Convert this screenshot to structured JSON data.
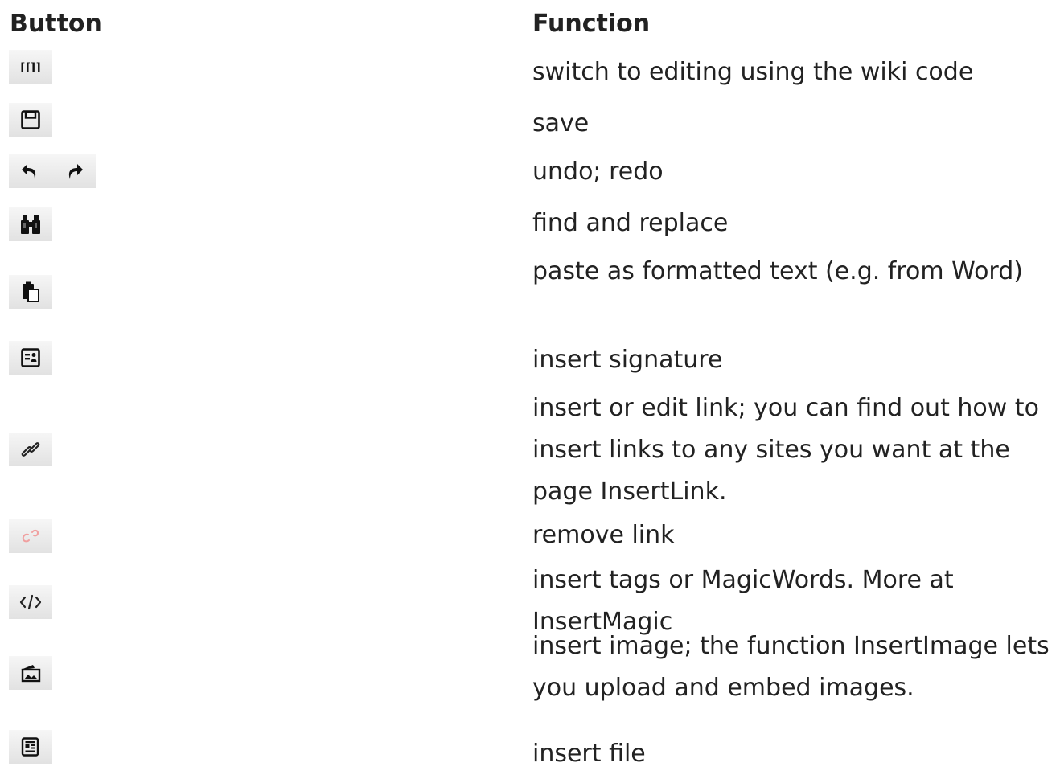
{
  "header": {
    "button": "Button",
    "function": "Function"
  },
  "rows": [
    {
      "icons": [
        "wiki-code-icon"
      ],
      "function": "switch to editing using the wiki code"
    },
    {
      "icons": [
        "floppy-disk-icon"
      ],
      "function": "save"
    },
    {
      "icons": [
        "undo-icon",
        "redo-icon"
      ],
      "function": "undo; redo"
    },
    {
      "icons": [
        "binoculars-icon"
      ],
      "function": "find and replace"
    },
    {
      "icons": [
        "paste-formatted-icon"
      ],
      "function": "paste as formatted text (e.g. from Word)"
    },
    {
      "icons": [
        "signature-icon"
      ],
      "function": "insert signature"
    },
    {
      "icons": [
        "link-icon"
      ],
      "function": "insert or edit link; you can find out how to insert links to any sites you want at the page InsertLink."
    },
    {
      "icons": [
        "unlink-icon"
      ],
      "function": "remove link"
    },
    {
      "icons": [
        "code-tags-icon"
      ],
      "function": "insert tags or MagicWords. More at InsertMagic"
    },
    {
      "icons": [
        "image-icon"
      ],
      "function": "insert image; the function InsertImage lets you upload and embed images."
    },
    {
      "icons": [
        "file-icon"
      ],
      "function": "insert file"
    }
  ],
  "colors": {
    "text": "#222222",
    "button_bg": "#eeeeee",
    "unlink": "#f0a0a0"
  }
}
